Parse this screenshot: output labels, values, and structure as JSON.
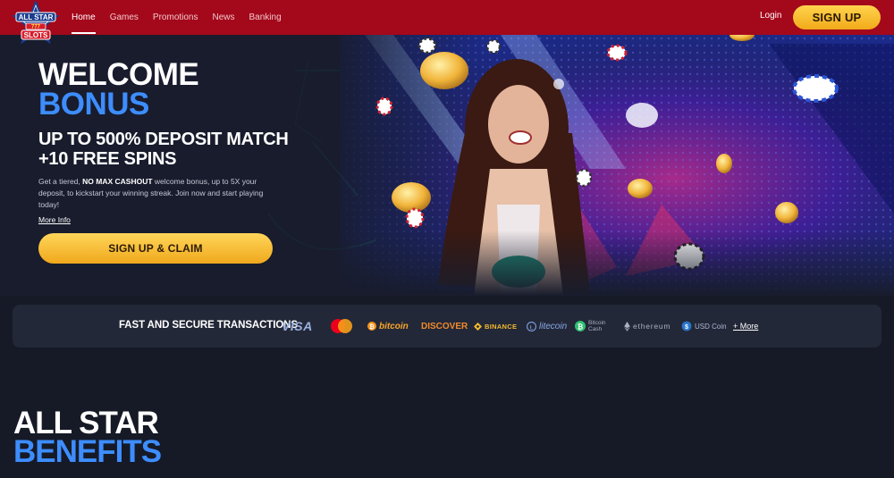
{
  "brand": {
    "logo_line1": "ALL STAR",
    "logo_line2": "SLOTS",
    "logo_badge": "777"
  },
  "nav": {
    "items": [
      {
        "label": "Home",
        "active": true
      },
      {
        "label": "Games",
        "active": false
      },
      {
        "label": "Promotions",
        "active": false
      },
      {
        "label": "News",
        "active": false
      },
      {
        "label": "Banking",
        "active": false
      }
    ],
    "login_label": "Login",
    "signup_label": "SIGN UP"
  },
  "hero": {
    "title_line1": "WELCOME",
    "title_line2": "BONUS",
    "offer_line1": "UP TO 500% DEPOSIT MATCH",
    "offer_line2": "+10 FREE SPINS",
    "desc_before": "Get a tiered, ",
    "desc_bold": "NO MAX CASHOUT",
    "desc_after": " welcome bonus, up to 5X your deposit, to kickstart your winning streak. Join now and start playing today!",
    "more_info_label": "More Info",
    "cta_label": "SIGN UP & CLAIM"
  },
  "payments": {
    "title": "FAST AND SECURE TRANSACTIONS",
    "methods": {
      "visa": "VISA",
      "bitcoin": "bitcoin",
      "discover": "DISCOVER",
      "binance": "BINANCE",
      "litecoin": "litecoin",
      "bitcoin_cash_1": "Bitcoin",
      "bitcoin_cash_2": "Cash",
      "ethereum": "ethereum",
      "usd_coin": "USD Coin"
    },
    "more_label": "+ More"
  },
  "benefits": {
    "title_line1": "ALL STAR",
    "title_line2": "BENEFITS"
  },
  "colors": {
    "nav_red": "#a4081b",
    "gold": "#f5b92a",
    "accent_blue": "#3d8dff",
    "page_bg": "#161a26"
  }
}
